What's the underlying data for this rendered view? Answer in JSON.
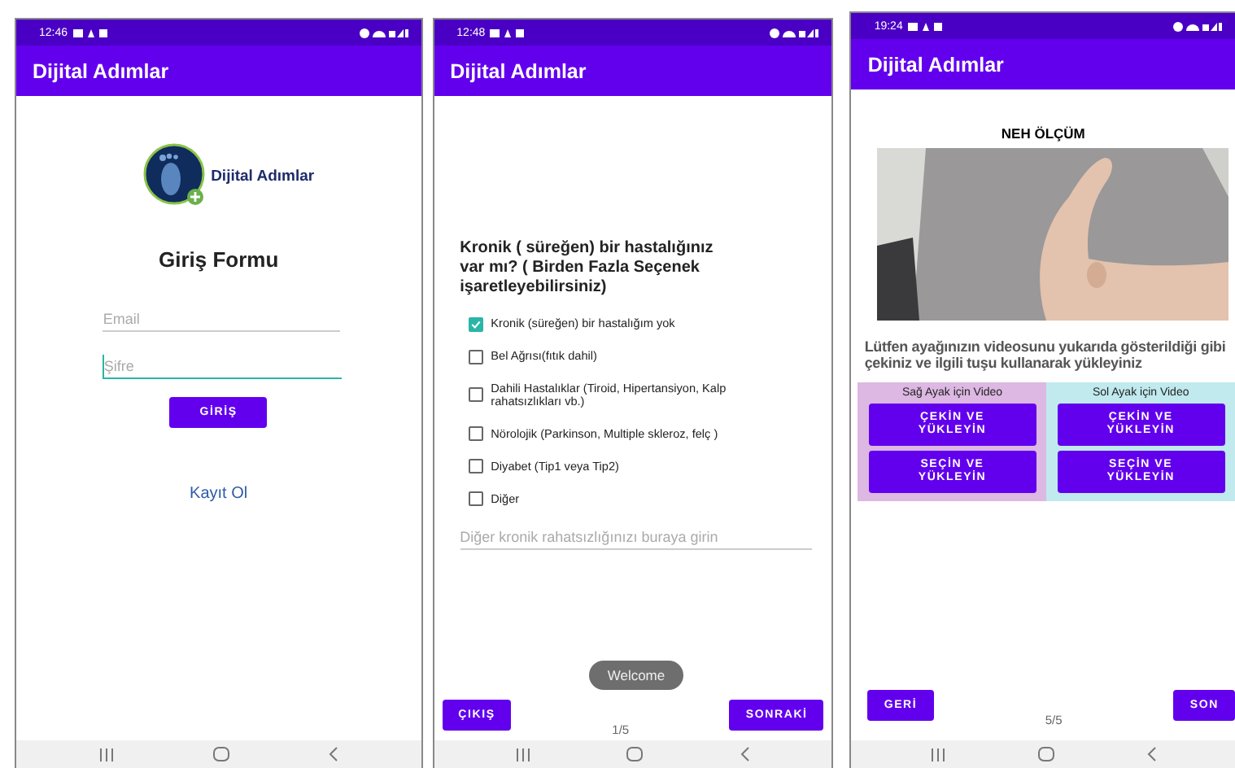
{
  "screens": [
    {
      "kind": "login",
      "time": "12:46",
      "app_title": "Dijital Adımlar",
      "logo_text": "Dijital Adımlar",
      "form_title": "Giriş Formu",
      "fields": [
        {
          "placeholder": "Email",
          "focused": false
        },
        {
          "placeholder": "Şifre",
          "focused": true
        }
      ],
      "submit": "GİRİŞ",
      "link": "Kayıt Ol"
    },
    {
      "kind": "survey",
      "time": "12:48",
      "app_title": "Dijital Adımlar",
      "question": "Kronik ( süreğen) bir hastalığınız var mı? ( Birden Fazla Seçenek işaretleyebilirsiniz)",
      "options": [
        {
          "label": "Kronik (süreğen) bir hastalığım yok",
          "checked": true
        },
        {
          "label": "Bel Ağrısı(fıtık dahil)",
          "checked": false
        },
        {
          "label": "Dahili Hastalıklar (Tiroid, Hipertansiyon, Kalp rahatsızlıkları vb.)",
          "checked": false
        },
        {
          "label": "Nörolojik (Parkinson, Multiple skleroz, felç )",
          "checked": false
        },
        {
          "label": "Diyabet (Tip1 veya Tip2)",
          "checked": false
        },
        {
          "label": "Diğer",
          "checked": false
        }
      ],
      "other_field": {
        "placeholder": "Diğer kronik rahatsızlığınızı buraya girin"
      },
      "toast": "Welcome",
      "back": "ÇIKIŞ",
      "page": "1/5",
      "next": "SONRAKİ"
    },
    {
      "kind": "measure",
      "time": "19:24",
      "app_title": "Dijital Adımlar",
      "heading": "NEH ÖLÇÜM",
      "picture": {
        "kind": "picture"
      },
      "instruction": "Lütfen ayağınızın videosunu yukarıda gösterildiği gibi çekiniz ve ilgili tuşu kullanarak yükleyiniz",
      "panels": [
        {
          "title": "Sağ Ayak için Video",
          "color": "#dcb8e2",
          "buttons": [
            "ÇEKİN VE YÜKLEYİN",
            "SEÇİN VE YÜKLEYİN"
          ]
        },
        {
          "title": "Sol Ayak için Video",
          "color": "#c0eaee",
          "buttons": [
            "ÇEKİN VE YÜKLEYİN",
            "SEÇİN  VE YÜKLEYİN"
          ]
        }
      ],
      "back": "GERİ",
      "page": "5/5",
      "next": "SON"
    }
  ]
}
